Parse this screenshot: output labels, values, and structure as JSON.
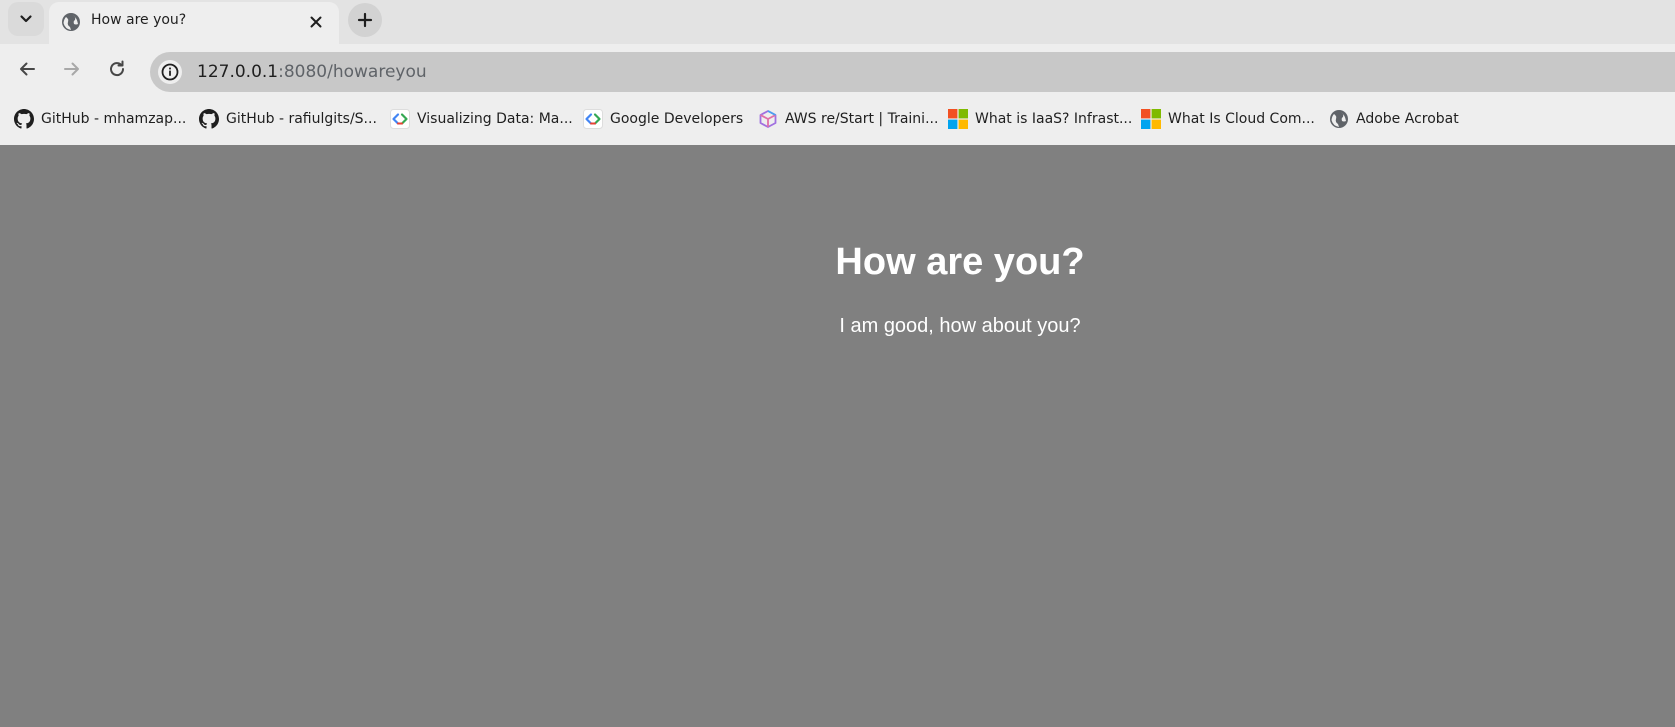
{
  "browser": {
    "tab": {
      "title": "How are you?",
      "favicon": "globe-icon"
    },
    "address": {
      "host": "127.0.0.1",
      "rest": ":8080/howareyou"
    },
    "bookmarks": [
      {
        "label": "GitHub - mhamzap...",
        "icon": "github-icon"
      },
      {
        "label": "GitHub - rafiulgits/S...",
        "icon": "github-icon"
      },
      {
        "label": "Visualizing Data: Ma...",
        "icon": "code-brackets-icon"
      },
      {
        "label": "Google Developers",
        "icon": "code-brackets-icon"
      },
      {
        "label": "AWS re/Start | Traini...",
        "icon": "cube-icon"
      },
      {
        "label": "What is IaaS? Infrast...",
        "icon": "microsoft-logo-icon"
      },
      {
        "label": "What Is Cloud Com...",
        "icon": "microsoft-logo-icon"
      },
      {
        "label": "Adobe Acrobat",
        "icon": "globe-icon"
      }
    ]
  },
  "page": {
    "heading": "How are you?",
    "paragraph": "I am good, how about you?",
    "background": "#808080",
    "text_color": "#ffffff"
  }
}
